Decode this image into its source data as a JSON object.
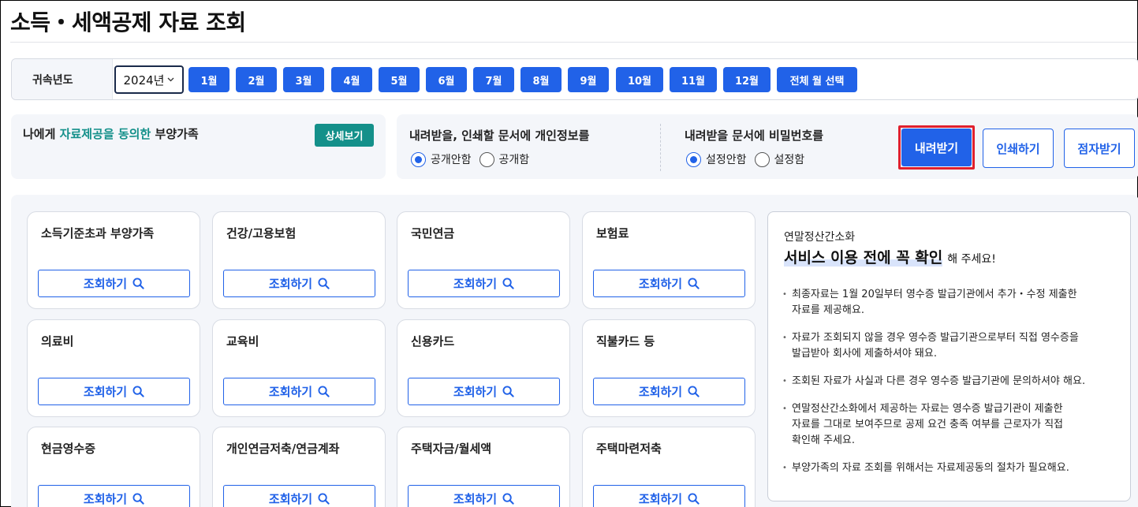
{
  "page": {
    "title": "소득・세액공제 자료 조회"
  },
  "yearbar": {
    "label": "귀속년도",
    "year": "2024년",
    "months": [
      "1월",
      "2월",
      "3월",
      "4월",
      "5월",
      "6월",
      "7월",
      "8월",
      "9월",
      "10월",
      "11월",
      "12월"
    ],
    "all_months": "전체 월 선택"
  },
  "consent": {
    "prefix": "나에게 ",
    "highlight": "자료제공을 동의한",
    "suffix": " 부양가족",
    "detail_button": "상세보기"
  },
  "privacy": {
    "title": "내려받을, 인쇄할 문서에 개인정보를",
    "options": [
      "공개안함",
      "공개함"
    ],
    "selected": 0
  },
  "password": {
    "title": "내려받을 문서에 비밀번호를",
    "options": [
      "설정안함",
      "설정함"
    ],
    "selected": 0
  },
  "actions": {
    "download": "내려받기",
    "print": "인쇄하기",
    "braille": "점자받기"
  },
  "cards": {
    "query_label": "조회하기",
    "items": [
      "소득기준초과 부양가족",
      "건강/고용보험",
      "국민연금",
      "보험료",
      "의료비",
      "교육비",
      "신용카드",
      "직불카드 등",
      "현금영수증",
      "개인연금저축/연금계좌",
      "주택자금/월세액",
      "주택마련저축"
    ]
  },
  "notice": {
    "subtitle": "연말정산간소화",
    "headline": "서비스 이용 전에 꼭 확인",
    "headline_tail": "해 주세요!",
    "items": [
      "최종자료는 1월 20일부터 영수증 발급기관에서 추가・수정 제출한\n자료를 제공해요.",
      "자료가 조회되지 않을 경우 영수증 발급기관으로부터 직접 영수증을\n발급받아 회사에 제출하셔야 돼요.",
      "조회된 자료가 사실과 다른 경우 영수증 발급기관에 문의하셔야 해요.",
      "연말정산간소화에서 제공하는 자료는 영수증 발급기관이 제출한\n자료를 그대로 보여주므로 공제 요건 충족 여부를 근로자가 직접\n확인해 주세요.",
      "부양가족의 자료 조회를 위해서는 자료제공동의 절차가 필요해요."
    ]
  },
  "colors": {
    "primary": "#2162e8",
    "teal": "#14908a",
    "highlight_border": "#e0202e",
    "panel_bg": "#f4f6fa"
  }
}
